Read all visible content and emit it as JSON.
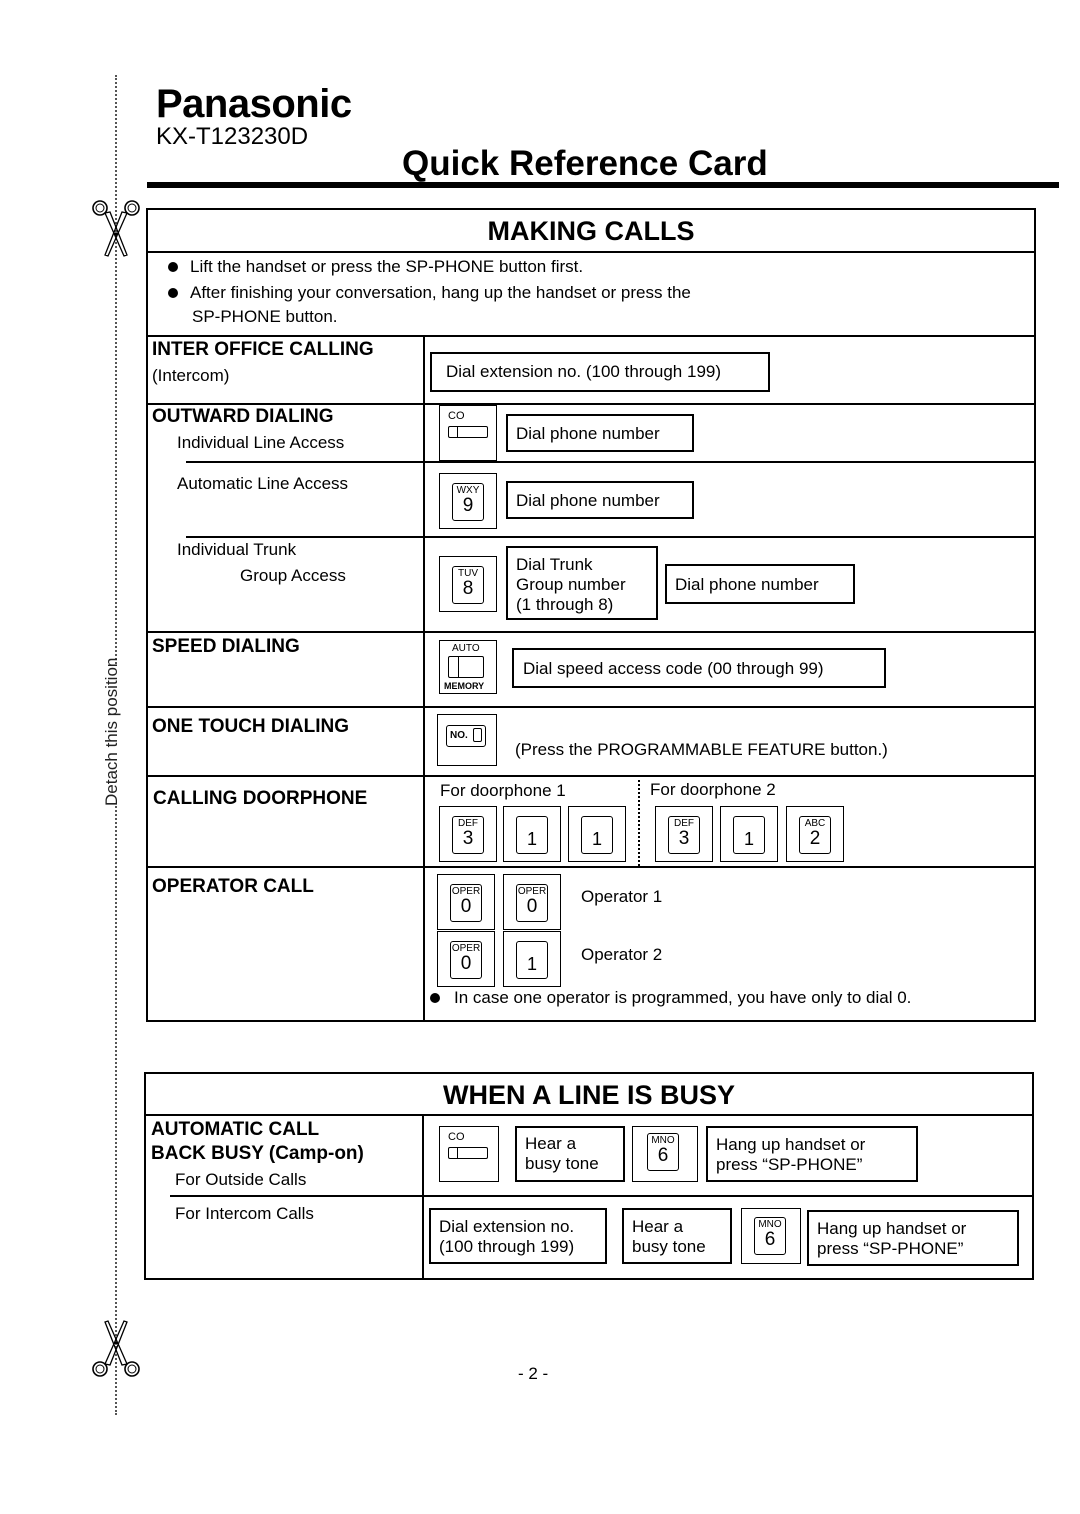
{
  "header": {
    "brand": "Panasonic",
    "model": "KX-T123230D",
    "title": "Quick Reference Card"
  },
  "margin": {
    "detach_label": "Detach this position",
    "icons": [
      "scissors-icon",
      "scissors-icon"
    ]
  },
  "making_calls": {
    "title": "MAKING CALLS",
    "bullets": [
      "Lift the handset or press the SP-PHONE button first.",
      "After finishing your conversation, hang up the handset or press the",
      "SP-PHONE button."
    ],
    "inter_office": {
      "title": "INTER OFFICE CALLING",
      "subtitle": "(Intercom)",
      "step": "Dial extension no. (100 through 199)"
    },
    "outward": {
      "title": "OUTWARD DIALING",
      "individual_line": {
        "label": "Individual Line Access",
        "key_label": "CO",
        "step": "Dial phone number"
      },
      "automatic_line": {
        "label": "Automatic Line Access",
        "key_letters": "WXY",
        "key_digit": "9",
        "step": "Dial phone number"
      },
      "trunk_group": {
        "label_line1": "Individual Trunk",
        "label_line2": "Group Access",
        "key_letters": "TUV",
        "key_digit": "8",
        "step1_line1": "Dial Trunk",
        "step1_line2": "Group number",
        "step1_line3": "(1 through 8)",
        "step2": "Dial phone number"
      }
    },
    "speed": {
      "title": "SPEED DIALING",
      "key_top": "AUTO",
      "key_bottom": "MEMORY",
      "step": "Dial speed access code (00 through 99)"
    },
    "one_touch": {
      "title": "ONE TOUCH DIALING",
      "key_label": "NO.",
      "note": "(Press the PROGRAMMABLE FEATURE button.)"
    },
    "doorphone": {
      "title": "CALLING DOORPHONE",
      "door1_label": "For doorphone 1",
      "door2_label": "For doorphone 2",
      "door1_keys": [
        {
          "letters": "DEF",
          "digit": "3"
        },
        {
          "letters": "",
          "digit": "1"
        },
        {
          "letters": "",
          "digit": "1"
        }
      ],
      "door2_keys": [
        {
          "letters": "DEF",
          "digit": "3"
        },
        {
          "letters": "",
          "digit": "1"
        },
        {
          "letters": "ABC",
          "digit": "2"
        }
      ]
    },
    "operator": {
      "title": "OPERATOR CALL",
      "op1_label": "Operator 1",
      "op2_label": "Operator 2",
      "op1_keys": [
        {
          "letters": "OPER",
          "digit": "0"
        },
        {
          "letters": "OPER",
          "digit": "0"
        }
      ],
      "op2_keys": [
        {
          "letters": "OPER",
          "digit": "0"
        },
        {
          "letters": "",
          "digit": "1"
        }
      ],
      "note": "In case one operator is programmed, you have only to dial 0."
    }
  },
  "line_busy": {
    "title": "WHEN A LINE IS BUSY",
    "camp_on": {
      "title_line1": "AUTOMATIC CALL",
      "title_line2": "BACK BUSY (Camp-on)",
      "outside_label": "For Outside Calls",
      "intercom_label": "For Intercom Calls"
    },
    "outside": {
      "key_label": "CO",
      "step1_line1": "Hear a",
      "step1_line2": "busy tone",
      "key_letters": "MNO",
      "key_digit": "6",
      "step2_line1": "Hang up handset or",
      "step2_line2": "press “SP-PHONE”"
    },
    "intercom": {
      "step1_line1": "Dial extension no.",
      "step1_line2": "(100 through 199)",
      "step2_line1": "Hear a",
      "step2_line2": "busy tone",
      "key_letters": "MNO",
      "key_digit": "6",
      "step3_line1": "Hang up handset or",
      "step3_line2": "press “SP-PHONE”"
    }
  },
  "footer": {
    "page_number": "- 2 -"
  }
}
